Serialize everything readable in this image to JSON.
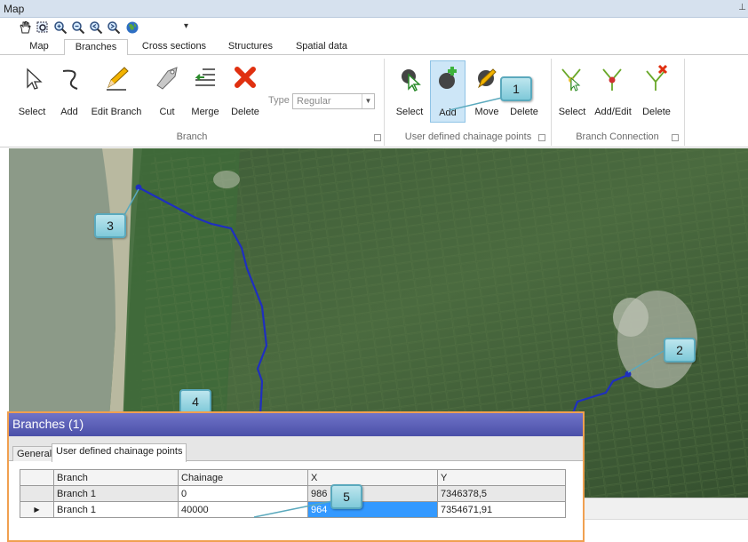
{
  "window": {
    "title": "Map",
    "pin": "⊥"
  },
  "quick_toolbar": {
    "icons": [
      "pan-hand-icon",
      "zoom-box-icon",
      "zoom-in-icon",
      "zoom-out-icon",
      "zoom-previous-icon",
      "zoom-next-icon",
      "globe-icon"
    ],
    "overflow": "▾"
  },
  "tabs": [
    "Map",
    "Branches",
    "Cross sections",
    "Structures",
    "Spatial data"
  ],
  "active_tab": "Branches",
  "ribbon": {
    "branch_group": {
      "label": "Branch",
      "buttons": [
        "Select",
        "Add",
        "Edit Branch",
        "Cut",
        "Merge",
        "Delete"
      ],
      "type_label": "Type",
      "type_value": "Regular"
    },
    "chainage_group": {
      "label": "User defined chainage points",
      "buttons": [
        "Select",
        "Add",
        "Move",
        "Delete"
      ]
    },
    "connection_group": {
      "label": "Branch Connection",
      "buttons": [
        "Select",
        "Add/Edit",
        "Delete"
      ]
    }
  },
  "callouts": [
    "1",
    "2",
    "3",
    "4",
    "5"
  ],
  "panel": {
    "title": "Branches (1)",
    "tabs": [
      "General",
      "User defined chainage points"
    ],
    "active_tab": "User defined chainage points",
    "columns": [
      "Branch",
      "Chainage",
      "X",
      "Y"
    ],
    "rows": [
      {
        "branch": "Branch 1",
        "chainage": "0",
        "x": "986",
        "y": "7346378,5"
      },
      {
        "branch": "Branch 1",
        "chainage": "40000",
        "x": "964",
        "y": "7354671,91"
      }
    ],
    "current_row_marker": "▶"
  },
  "colors": {
    "branch_line": "#1f2fbf",
    "callout": "#8fd0de",
    "panel_border": "#f0a050",
    "panel_title": "#5a5fb8"
  }
}
